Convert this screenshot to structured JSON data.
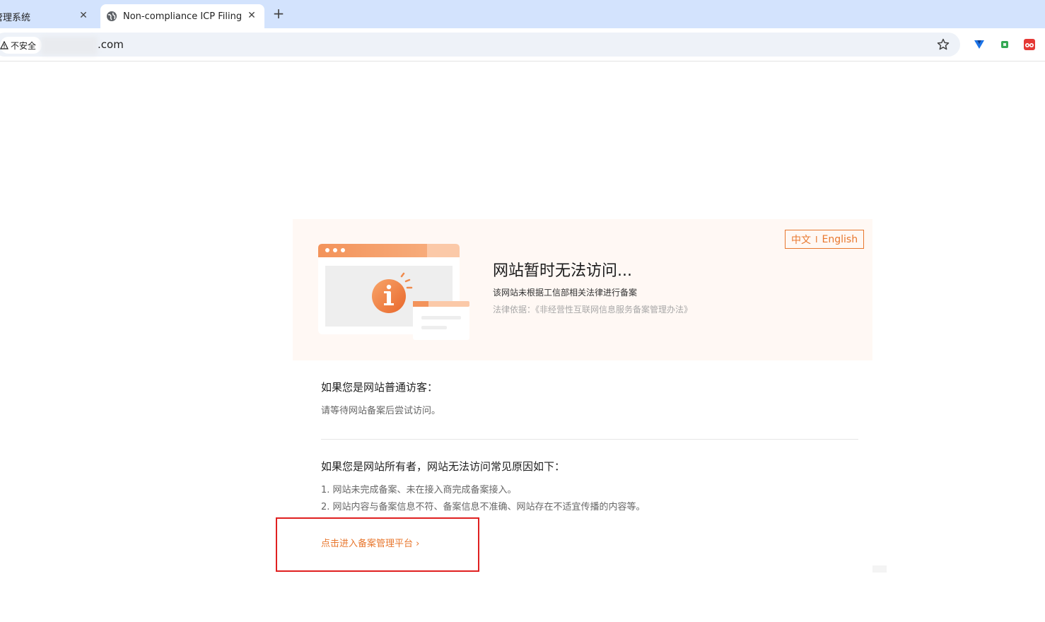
{
  "browser": {
    "tabs": [
      {
        "title": "管理系统",
        "close": "✕",
        "active": false
      },
      {
        "title": "Non-compliance ICP Filing",
        "close": "✕",
        "active": true
      }
    ],
    "new_tab": "+",
    "security_label": "不安全",
    "url_suffix": ".com",
    "icons": [
      "globe-icon",
      "warning-icon",
      "star-icon",
      "extension-icon"
    ]
  },
  "banner": {
    "lang_zh": "中文",
    "lang_sep": "I",
    "lang_en": "English",
    "title": "网站暂时无法访问...",
    "description": "该网站未根据工信部相关法律进行备案",
    "law": "法律依据：《非经营性互联网信息服务备案管理办法》"
  },
  "visitor": {
    "heading": "如果您是网站普通访客：",
    "text": "请等待网站备案后尝试访问。"
  },
  "owner": {
    "heading": "如果您是网站所有者，网站无法访问常见原因如下：",
    "reasons": [
      "1. 网站未完成备案、未在接入商完成备案接入。",
      "2. 网站内容与备案信息不符、备案信息不准确、网站存在不适宜传播的内容等。"
    ]
  },
  "link": {
    "label": "点击进入备案管理平台 ›"
  },
  "colors": {
    "accent": "#e8772e",
    "highlight": "#e02020",
    "tabstrip": "#d3e3fd"
  }
}
